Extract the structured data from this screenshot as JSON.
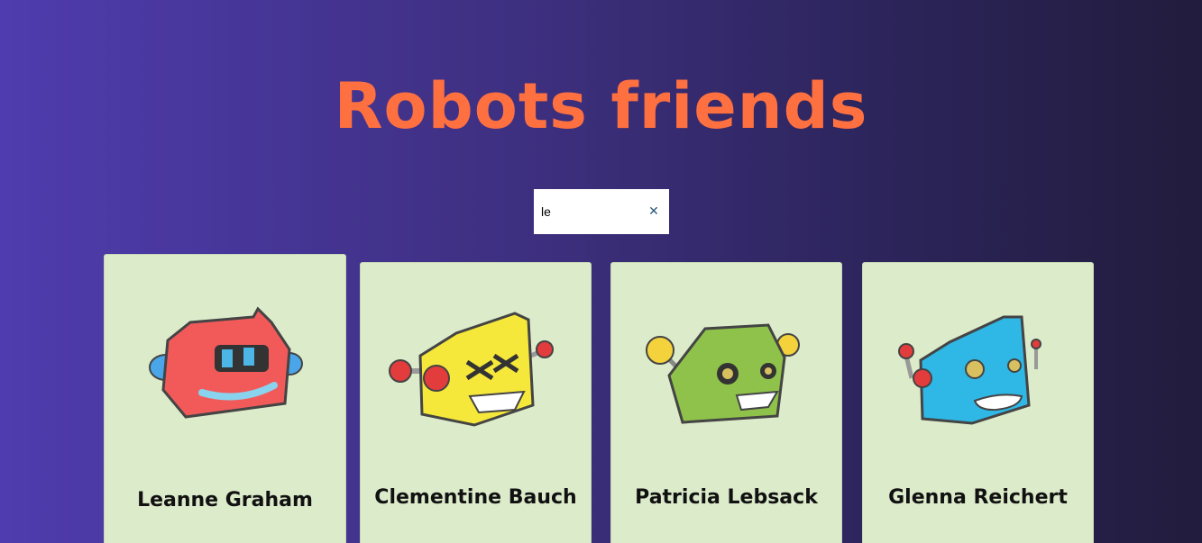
{
  "header": {
    "title": "Robots friends"
  },
  "search": {
    "value": "le",
    "clear_icon": "close-icon"
  },
  "robots": [
    {
      "name": "Leanne Graham",
      "color": "#f25a5a"
    },
    {
      "name": "Clementine Bauch",
      "color": "#f6e83a"
    },
    {
      "name": "Patricia Lebsack",
      "color": "#8fc24a"
    },
    {
      "name": "Glenna Reichert",
      "color": "#2fb8e6"
    }
  ]
}
